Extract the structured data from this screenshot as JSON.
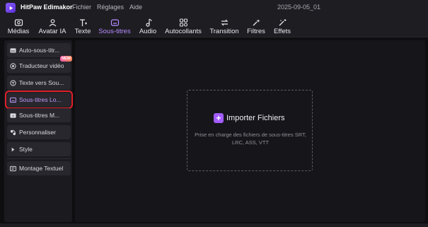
{
  "app": {
    "title": "HitPaw Edimakor",
    "project": "2025-09-05_01"
  },
  "menu": [
    "Fichier",
    "Réglages",
    "Aide"
  ],
  "toolbar": {
    "tabs": [
      {
        "label": "Médias",
        "icon": "media-icon"
      },
      {
        "label": "Avatar IA",
        "icon": "avatar-icon"
      },
      {
        "label": "Texte",
        "icon": "text-icon"
      },
      {
        "label": "Sous-titres",
        "icon": "subtitles-icon",
        "active": true
      },
      {
        "label": "Audio",
        "icon": "audio-icon"
      },
      {
        "label": "Autocollants",
        "icon": "stickers-icon"
      },
      {
        "label": "Transition",
        "icon": "transition-icon"
      },
      {
        "label": "Filtres",
        "icon": "filters-icon"
      },
      {
        "label": "Effets",
        "icon": "effects-icon"
      }
    ]
  },
  "sidebar": {
    "items": [
      {
        "label": "Auto-sous-titr...",
        "icon": "cc-icon"
      },
      {
        "label": "Traducteur vidéo",
        "icon": "translate-icon",
        "badge": "NEW"
      },
      {
        "label": "Texte vers Sou...",
        "icon": "text-to-subtitle-icon"
      },
      {
        "label": "Sous-titres Lo...",
        "icon": "local-subtitles-icon",
        "selected": true
      },
      {
        "label": "Sous-titres M...",
        "icon": "manual-subtitles-icon"
      },
      {
        "label": "Personnaliser",
        "icon": "customize-icon"
      },
      {
        "label": "Style",
        "icon": "triangle-right-icon"
      },
      {
        "label": "Montage Textuel",
        "icon": "text-edit-icon"
      }
    ]
  },
  "main": {
    "import_label": "Importer Fichiers",
    "import_desc": "Prise en charge des fichiers de sous-titres SRT, LRC, ASS, VTT"
  },
  "colors": {
    "accent": "#a35cff",
    "highlight": "#e0202a",
    "background": "#0e0e11"
  }
}
